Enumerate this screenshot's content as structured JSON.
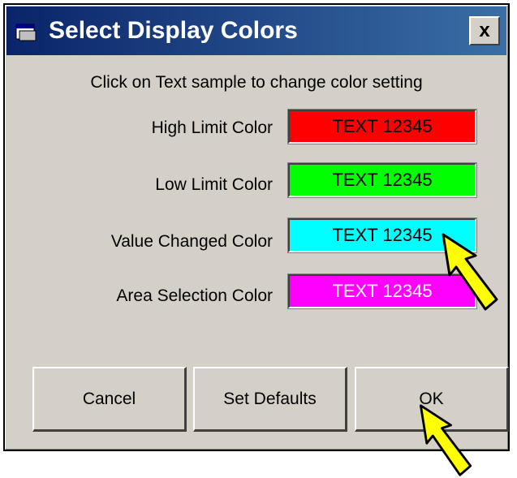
{
  "window": {
    "title": "Select Display Colors",
    "close_label": "x"
  },
  "instruction": "Click on Text sample to change color setting",
  "color_rows": [
    {
      "label": "High Limit Color",
      "sample_text": "TEXT 12345",
      "background": "#ff0000",
      "text_color": "#000000"
    },
    {
      "label": "Low Limit Color",
      "sample_text": "TEXT 12345",
      "background": "#00ff00",
      "text_color": "#000000"
    },
    {
      "label": "Value Changed Color",
      "sample_text": "TEXT 12345",
      "background": "#00ffff",
      "text_color": "#000000"
    },
    {
      "label": "Area Selection Color",
      "sample_text": "TEXT 12345",
      "background": "#ff00ff",
      "text_color": "#ffffff"
    }
  ],
  "buttons": {
    "cancel": "Cancel",
    "set_defaults": "Set Defaults",
    "ok": "OK"
  },
  "colors": {
    "title_bar": "#0a246a",
    "dialog_face": "#d4d0c8",
    "pointer_arrow": "#ffff00"
  },
  "annotations": {
    "pointer_icon": "yellow-arrow-icon"
  }
}
